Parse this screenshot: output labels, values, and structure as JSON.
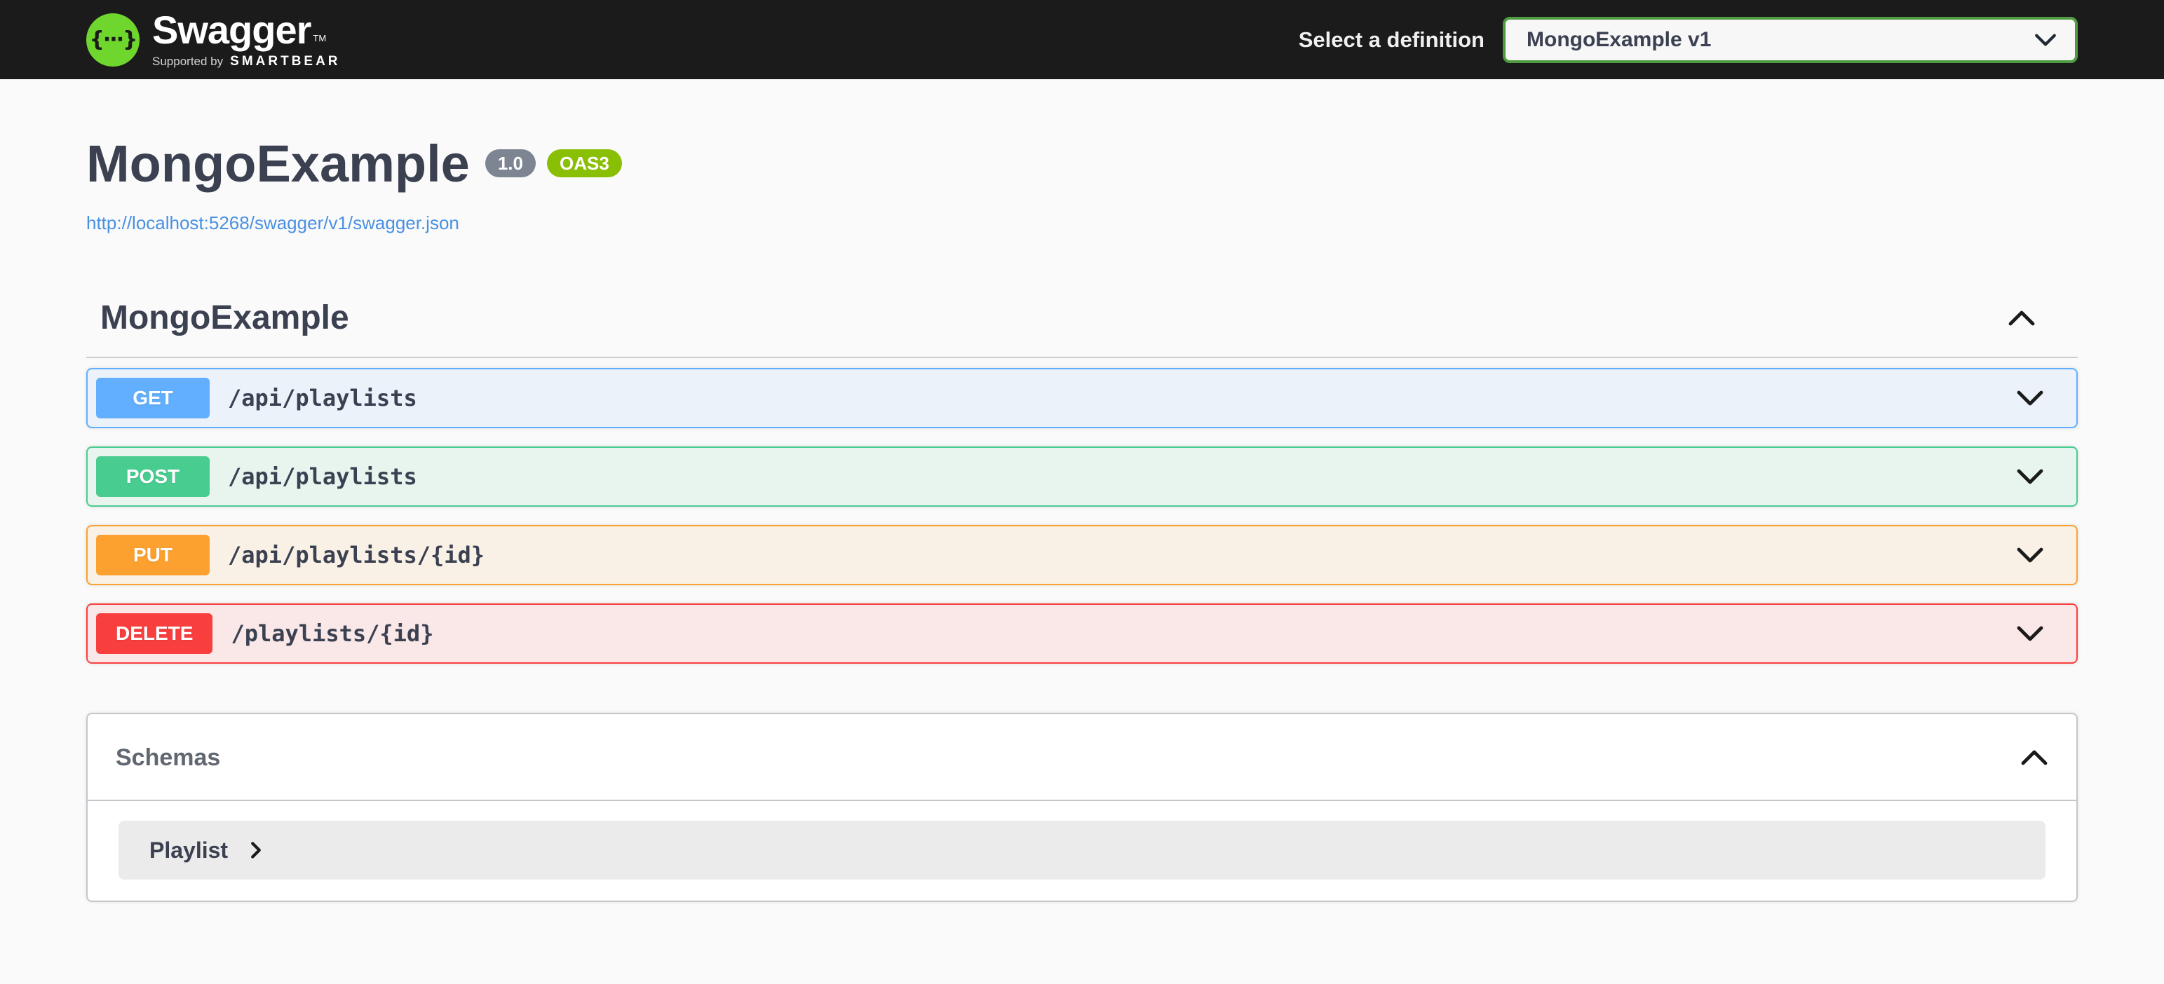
{
  "topbar": {
    "logo_glyph": "{···}",
    "logo_text": "Swagger",
    "logo_tm": "TM",
    "supported_by_prefix": "Supported by",
    "supported_by_brand": "SMARTBEAR",
    "select_label": "Select a definition",
    "selected_definition": "MongoExample v1"
  },
  "info": {
    "title": "MongoExample",
    "version_badge": "1.0",
    "spec_badge": "OAS3",
    "spec_url": "http://localhost:5268/swagger/v1/swagger.json"
  },
  "tag_section": {
    "title": "MongoExample"
  },
  "operations": [
    {
      "method": "GET",
      "path": "/api/playlists",
      "color": "#61affe",
      "bg": "#ebf2fa"
    },
    {
      "method": "POST",
      "path": "/api/playlists",
      "color": "#49cc90",
      "bg": "#e8f5ef"
    },
    {
      "method": "PUT",
      "path": "/api/playlists/{id}",
      "color": "#fca130",
      "bg": "#faf1e6"
    },
    {
      "method": "DELETE",
      "path": "/playlists/{id}",
      "color": "#f93e3e",
      "bg": "#fae7e7"
    }
  ],
  "schemas": {
    "title": "Schemas",
    "models": [
      {
        "name": "Playlist"
      }
    ]
  },
  "colors": {
    "topbar_bg": "#1b1b1b",
    "page_bg": "#fafafa",
    "logo_green": "#6fd62d",
    "select_border": "#4f9b3f",
    "heading": "#3b4151",
    "link": "#4990e2",
    "version_badge_bg": "#7d8492",
    "oas_badge_bg": "#89bf04",
    "border_gray": "#c4c6cb",
    "model_panel_bg": "#ebebeb"
  }
}
